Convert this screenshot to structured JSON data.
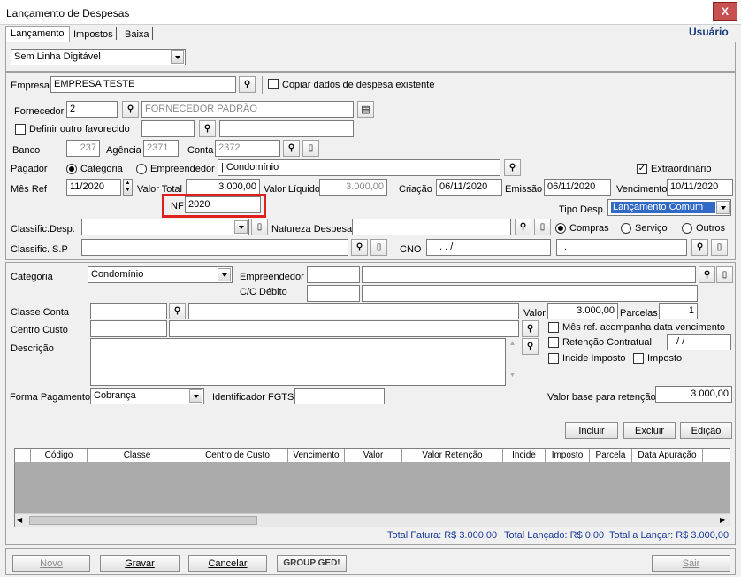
{
  "window": {
    "title": "Lançamento de Despesas",
    "user": "Usuário",
    "close": "X"
  },
  "tabs": [
    "Lançamento",
    "Impostos",
    "Baixa"
  ],
  "line_select": "Sem Linha Digitável",
  "empresa": {
    "label": "Empresa",
    "value": "EMPRESA TESTE",
    "copy_label": "Copiar dados de despesa existente"
  },
  "fornecedor": {
    "label": "Fornecedor",
    "code": "2",
    "name": "FORNECEDOR PADRÃO"
  },
  "favorecido": {
    "label": "Definir outro favorecido"
  },
  "banco": {
    "label": "Banco",
    "value": "237",
    "agencia_label": "Agência",
    "agencia": "2371",
    "conta_label": "Conta",
    "conta": "2372"
  },
  "pagador": {
    "label": "Pagador",
    "opt1": "Categoria",
    "opt2": "Empreendedor",
    "value": "| Condomínio",
    "extra_label": "Extraordinário",
    "extra_check": "✓"
  },
  "mesref": {
    "label": "Mês Ref",
    "value": "11/2020"
  },
  "valor_total": {
    "label": "Valor Total",
    "value": "3.000,00"
  },
  "valor_liquido": {
    "label": "Valor Líquido",
    "value": "3.000,00"
  },
  "criacao": {
    "label": "Criação",
    "value": "06/11/2020"
  },
  "emissao": {
    "label": "Emissão",
    "value": "06/11/2020"
  },
  "vencimento": {
    "label": "Vencimento",
    "value": "10/11/2020"
  },
  "nf": {
    "label": "NF",
    "value": "2020"
  },
  "tipo_desp": {
    "label": "Tipo Desp.",
    "value": "Lançamento Comum"
  },
  "classific_desp": {
    "label": "Classific.Desp."
  },
  "natureza": {
    "label": "Natureza Despesa",
    "opt1": "Compras",
    "opt2": "Serviço",
    "opt3": "Outros"
  },
  "classific_sp": {
    "label": "Classific. S.P",
    "cno_label": "CNO",
    "cno_value": ". . /",
    "cno_value2": "."
  },
  "categoria": {
    "label": "Categoria",
    "value": "Condomínio"
  },
  "empreendedor": {
    "label": "Empreendedor"
  },
  "cc_debito": {
    "label": "C/C Débito"
  },
  "classe_conta": {
    "label": "Classe Conta"
  },
  "valor": {
    "label": "Valor",
    "value": "3.000,00"
  },
  "parcelas": {
    "label": "Parcelas",
    "value": "1"
  },
  "centro_custo": {
    "label": "Centro Custo"
  },
  "mes_ref_check": "Mês ref. acompanha data vencimento",
  "retencao": {
    "label": "Retenção Contratual",
    "value": "/ /"
  },
  "incide_imposto": "Incide Imposto",
  "imposto": "Imposto",
  "descricao": {
    "label": "Descrição"
  },
  "forma_pagamento": {
    "label": "Forma Pagamento",
    "value": "Cobrança"
  },
  "fgts": {
    "label": "Identificador FGTS"
  },
  "valor_base": {
    "label": "Valor base para retenção",
    "value": "3.000,00"
  },
  "grid_buttons": {
    "incluir": "Incluir",
    "excluir": "Excluir",
    "edicao": "Edição"
  },
  "grid_columns": [
    "Código",
    "Classe",
    "Centro de Custo",
    "Vencimento",
    "Valor",
    "Valor Retenção",
    "Incide",
    "Imposto",
    "Parcela",
    "Data Apuração"
  ],
  "totals": {
    "fatura": "Total Fatura: R$ 3.000,00",
    "lancado": "Total Lançado: R$ 0,00",
    "a_lancar": "Total a Lançar: R$ 3.000,00"
  },
  "footer": {
    "novo": "Novo",
    "gravar": "Gravar",
    "cancelar": "Cancelar",
    "logo": "GROUP GED!",
    "sair": "Sair"
  }
}
